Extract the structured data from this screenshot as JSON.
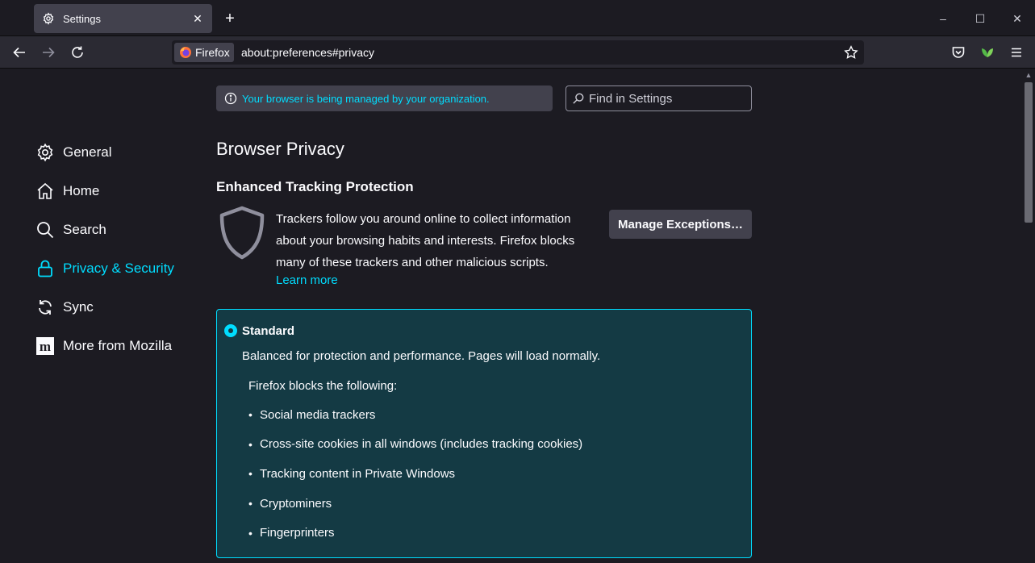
{
  "tab": {
    "title": "Settings",
    "close_glyph": "✕",
    "icon": "gear-icon"
  },
  "new_tab_glyph": "+",
  "window_controls": {
    "minimize": "–",
    "maximize": "☐",
    "close": "✕"
  },
  "urlbar": {
    "identity_label": "Firefox",
    "url": "about:preferences#privacy"
  },
  "sidebar": {
    "items": [
      {
        "label": "General",
        "icon": "gear-icon",
        "selected": false
      },
      {
        "label": "Home",
        "icon": "home-icon",
        "selected": false
      },
      {
        "label": "Search",
        "icon": "search-icon",
        "selected": false
      },
      {
        "label": "Privacy & Security",
        "icon": "lock-icon",
        "selected": true
      },
      {
        "label": "Sync",
        "icon": "sync-icon",
        "selected": false
      },
      {
        "label": "More from Mozilla",
        "icon": "mozilla-icon",
        "selected": false
      }
    ]
  },
  "main": {
    "managed_notice": "Your browser is being managed by your organization.",
    "search_placeholder": "Find in Settings",
    "page_title": "Browser Privacy",
    "etp": {
      "title": "Enhanced Tracking Protection",
      "description": "Trackers follow you around online to collect information about your browsing habits and interests. Firefox blocks many of these trackers and other malicious scripts.",
      "learn_more": "Learn more",
      "manage_button": "Manage Exceptions…"
    },
    "standard": {
      "title": "Standard",
      "description": "Balanced for protection and performance. Pages will load normally.",
      "blocks_heading": "Firefox blocks the following:",
      "items": [
        "Social media trackers",
        "Cross-site cookies in all windows (includes tracking cookies)",
        "Tracking content in Private Windows",
        "Cryptominers",
        "Fingerprinters"
      ],
      "selected": true
    }
  },
  "colors": {
    "accent": "#00ddff",
    "background": "#1c1b22",
    "toolbar": "#2b2a33",
    "card": "#143a44"
  }
}
